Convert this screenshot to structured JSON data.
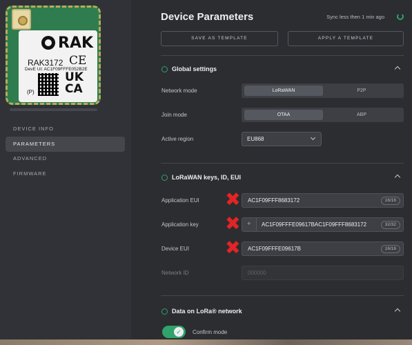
{
  "sidebar": {
    "module": {
      "brand": "RAK",
      "model": "RAK3172",
      "ce": "CE",
      "eui_line": "DevE UI: AC1F09FFFE052B2E",
      "p_mark": "(P)",
      "ukca": "UK CA"
    },
    "nav": [
      {
        "label": "DEVICE INFO"
      },
      {
        "label": "PARAMETERS"
      },
      {
        "label": "ADVANCED"
      },
      {
        "label": "FIRMWARE"
      }
    ]
  },
  "header": {
    "title": "Device Parameters",
    "sync_text": "Sync less then 1 min ago",
    "save_template": "SAVE AS TEMPLATE",
    "apply_template": "APPLY A TEMPLATE"
  },
  "global": {
    "title": "Global settings",
    "network_mode_label": "Network mode",
    "network_mode_options": [
      "LoRaWAN",
      "P2P"
    ],
    "join_mode_label": "Join mode",
    "join_mode_options": [
      "OTAA",
      "ABP"
    ],
    "region_label": "Active region",
    "region_value": "EU868"
  },
  "keys": {
    "title": "LoRaWAN keys, ID, EUI",
    "app_eui_label": "Application EUI",
    "app_eui_value": "AC1F09FFF8683172",
    "app_eui_count": "16/16",
    "app_key_label": "Application key",
    "app_key_value": "AC1F09FFFE09617BAC1F09FFF8683172",
    "app_key_count": "32/32",
    "dev_eui_label": "Device EUI",
    "dev_eui_value": "AC1F09FFFE09617B",
    "dev_eui_count": "16/16",
    "network_id_label": "Network ID",
    "network_id_value": "000000"
  },
  "lora": {
    "title": "Data on LoRa® network",
    "confirm_label": "Confirm mode"
  },
  "colors": {
    "accent": "#2fa36b",
    "annotation": "#e32424",
    "background": "#2b2d31"
  },
  "icons": {
    "sync": "refresh-icon",
    "info": "info-icon",
    "collapse": "chevron-up-icon",
    "key": "key-icon",
    "check": "check-icon",
    "annotation": "red-x-mark"
  }
}
